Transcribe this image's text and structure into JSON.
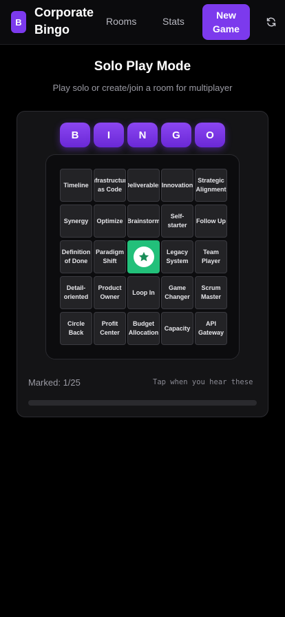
{
  "app": {
    "logo_letter": "B",
    "brand_line1": "Corporate",
    "brand_line2": "Bingo"
  },
  "nav": {
    "rooms": "Rooms",
    "stats": "Stats",
    "new_game": "New Game",
    "refresh_icon": "refresh-icon"
  },
  "page": {
    "title": "Solo Play Mode",
    "subtitle": "Play solo or create/join a room for multiplayer"
  },
  "bingo_letters": [
    "B",
    "I",
    "N",
    "G",
    "O"
  ],
  "board": {
    "cells": [
      "Timeline",
      "Infrastructure as Code",
      "Deliverables",
      "Innovation",
      "Strategic Alignment",
      "Synergy",
      "Optimize",
      "Brainstorm",
      "Self-starter",
      "Follow Up",
      "Definition of Done",
      "Paradigm Shift",
      "",
      "Legacy System",
      "Team Player",
      "Detail-oriented",
      "Product Owner",
      "Loop In",
      "Game Changer",
      "Scrum Master",
      "Circle Back",
      "Profit Center",
      "Budget Allocation",
      "Capacity",
      "API Gateway"
    ],
    "free_space_icon": "star-icon"
  },
  "status": {
    "marked": "Marked: 1/25",
    "hint": "Tap when you hear these",
    "progress_fraction": 0.04
  },
  "colors": {
    "accent": "#7c3aed",
    "free_space": "#22c07a",
    "background": "#000000"
  }
}
